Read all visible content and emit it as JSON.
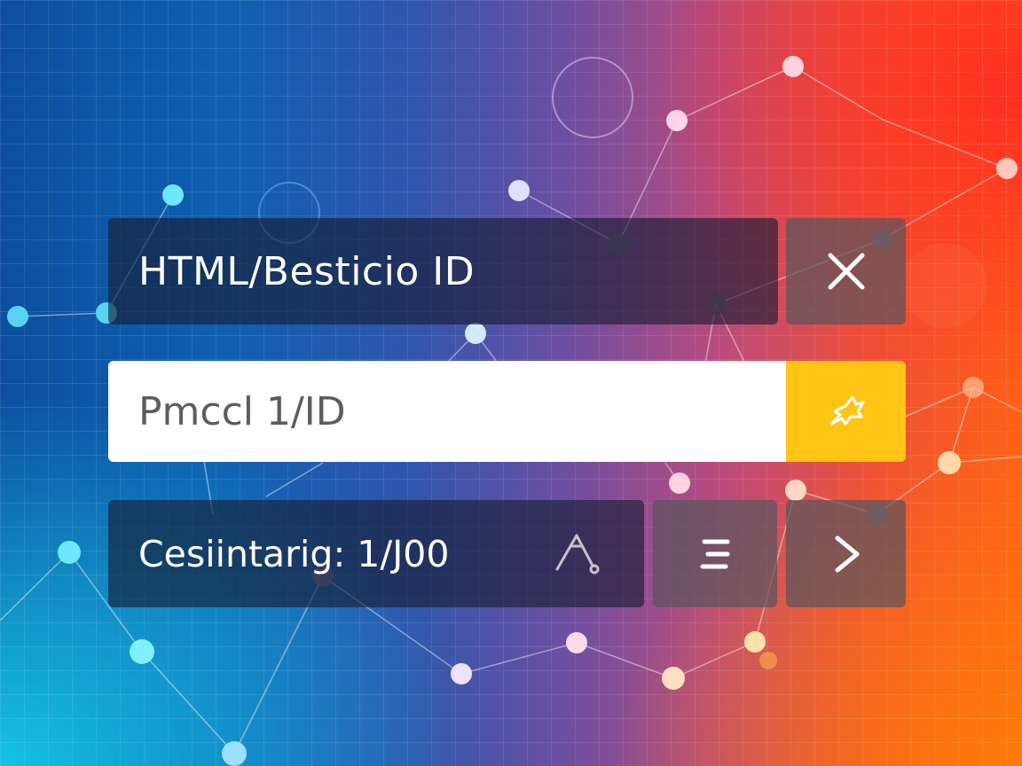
{
  "window": {
    "title": "HTML/Besticio ID"
  },
  "search": {
    "value": "Pmccl 1/ID"
  },
  "status": {
    "label": "Cesiintarig: 1/J00"
  },
  "icons": {
    "close": "close-icon",
    "action": "pin-icon",
    "tool": "scissors-icon",
    "menu": "menu-icon",
    "next": "chevron-right-icon"
  },
  "colors": {
    "accent": "#ffc414",
    "panel_dark": "#1b2236",
    "panel_grey": "#5a545c",
    "input_bg": "#ffffff"
  }
}
